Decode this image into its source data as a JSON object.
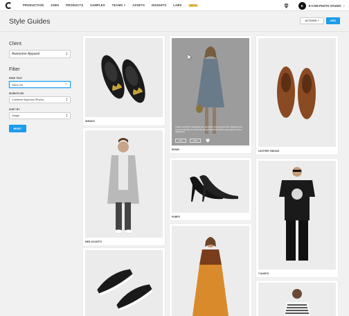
{
  "nav": {
    "items": [
      {
        "label": "PRODUCTION"
      },
      {
        "label": "JOBS"
      },
      {
        "label": "PRODUCTS"
      },
      {
        "label": "SAMPLES"
      },
      {
        "label": "TEAMS ˅"
      },
      {
        "label": "ASSETS"
      },
      {
        "label": "INSIGHTS"
      },
      {
        "label": "LABS"
      },
      {
        "label": "BETA"
      }
    ],
    "avatar_initial": "E",
    "studio_name": "E-COM PHOTO STUDIO",
    "studio_caret": "˅"
  },
  "header": {
    "title": "Style Guides",
    "actions_label": "ACTIONS ˅",
    "add_label": "ADD"
  },
  "sidebar": {
    "client_heading": "Client",
    "client_value": "Awesome Apparel",
    "filter_heading": "Filter",
    "free_text_label": "FREE TEXT",
    "free_text_value": "Swim SS",
    "workflow_label": "WORKFLOW",
    "workflow_value": "Customer Approval (Pixels)",
    "sort_label": "SORT BY",
    "sort_value": "Usage",
    "reset_label": "RESET",
    "clear_icon": "×",
    "arrows": "▲▼"
  },
  "cards": [
    {
      "label": "SNEAKS"
    },
    {
      "label": "DENIM"
    },
    {
      "label": "LEATHER SNEAKS"
    },
    {
      "label": "MEN JACKETS"
    },
    {
      "label": "PUMPS"
    },
    {
      "label": "T-SHIRTS"
    },
    {
      "label": ""
    },
    {
      "label": ""
    },
    {
      "label": ""
    }
  ],
  "overlay": {
    "text": "These oversized categories are detected and imported into catalog items. If you would like to upload the design workflow will be executed for these categories.",
    "btn_edit": "EDIT",
    "btn_view": "VIEW"
  },
  "colors": {
    "accent": "#1c9cea",
    "page_bg": "#f1f1f1",
    "beta_badge": "#f5d36a"
  }
}
